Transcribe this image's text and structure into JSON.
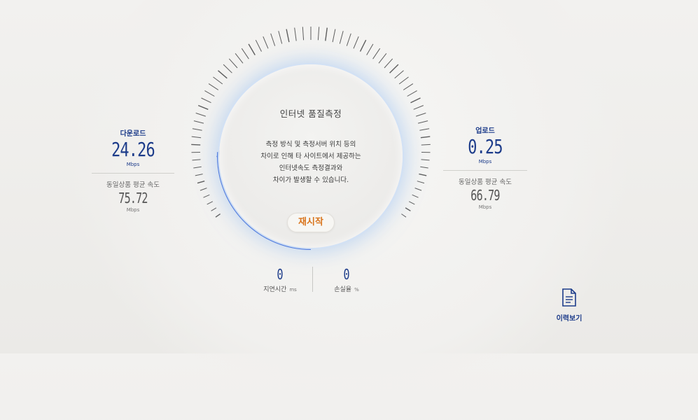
{
  "measure": {
    "title": "인터넷 품질측정",
    "description": [
      "측정 방식 및 측정서버 위치 등의",
      "차이로 인해 타 사이트에서 제공하는",
      "인터넷속도 측정결과와",
      "차이가 발생할 수 있습니다."
    ],
    "restart_label": "재시작",
    "gauge_fraction": 0.15
  },
  "download": {
    "label": "다운로드",
    "value": "24.26",
    "unit": "Mbps",
    "avg_label": "동일상품 평균 속도",
    "avg_value": "75.72",
    "avg_unit": "Mbps"
  },
  "upload": {
    "label": "업로드",
    "value": "0.25",
    "unit": "Mbps",
    "avg_label": "동일상품 평균 속도",
    "avg_value": "66.79",
    "avg_unit": "Mbps"
  },
  "latency": {
    "value": "0",
    "label": "지연시간",
    "unit": "ms"
  },
  "loss": {
    "value": "0",
    "label": "손실율",
    "unit": "%"
  },
  "history": {
    "label": "이력보기",
    "icon": "document-icon"
  },
  "colors": {
    "accent": "#1d3c8a",
    "progress": "#2b58d4",
    "restart": "#d9741c"
  }
}
